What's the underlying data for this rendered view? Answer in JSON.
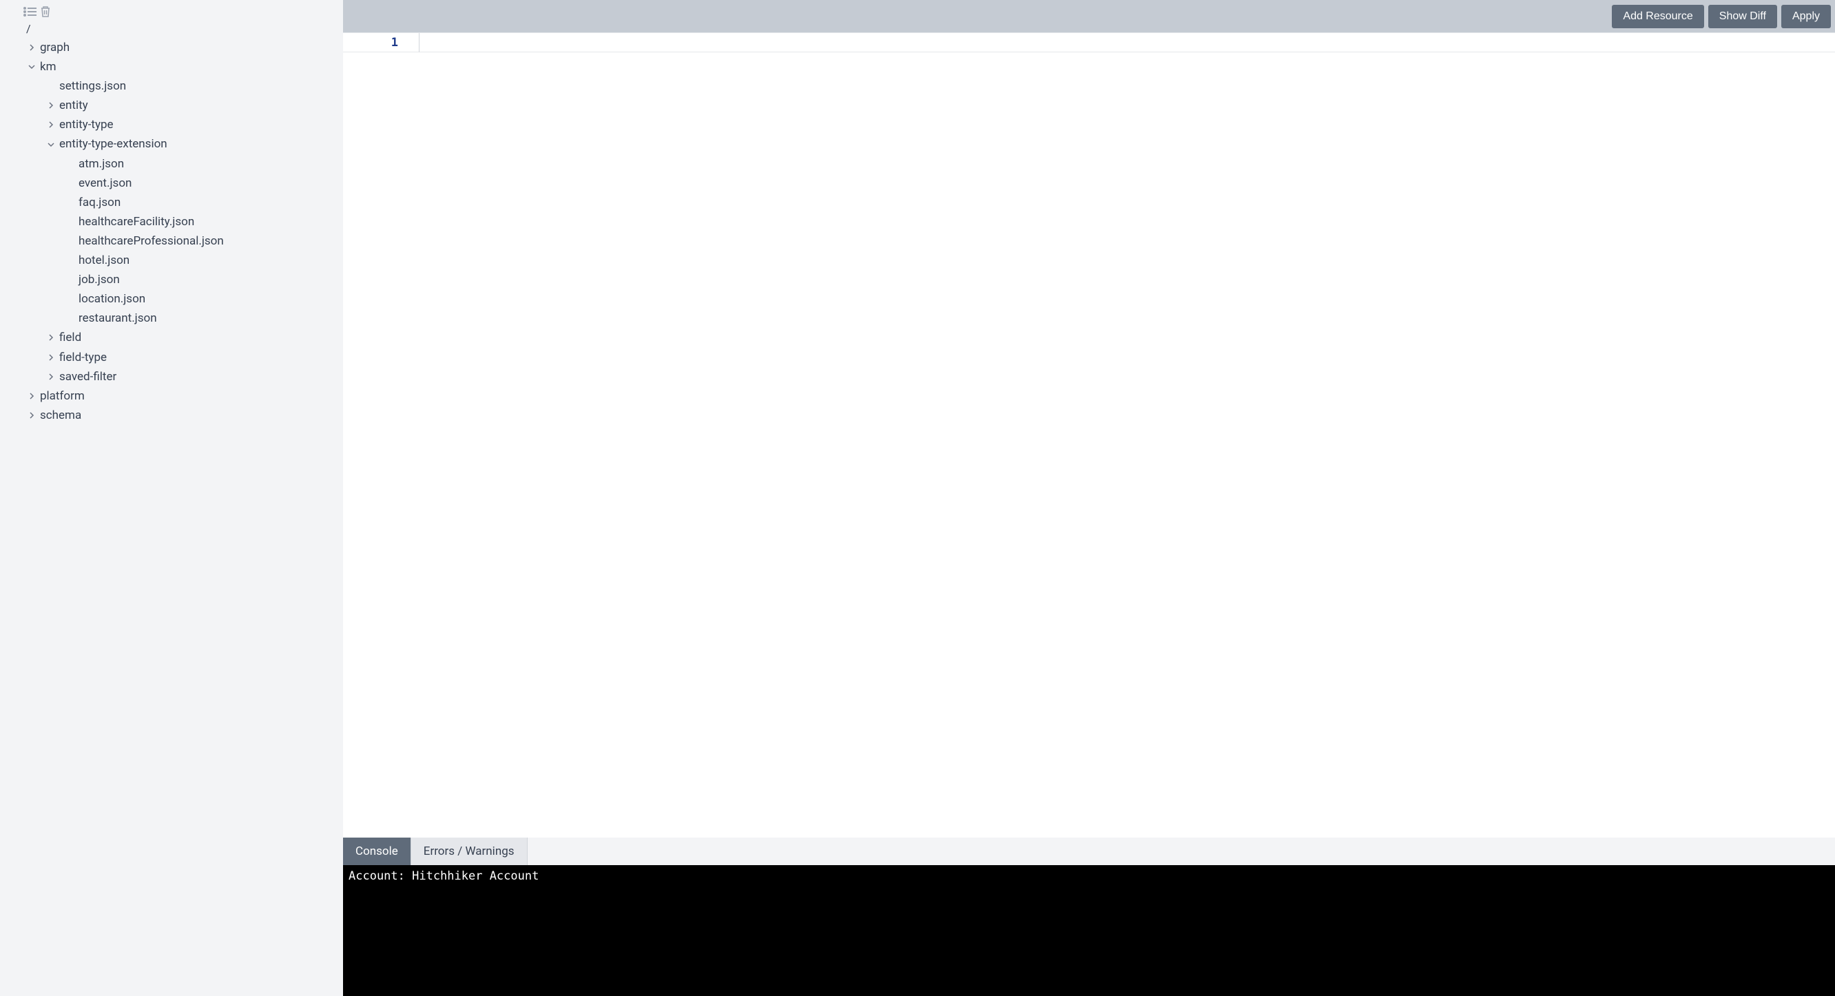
{
  "sidebar": {
    "root": "/",
    "items": [
      {
        "label": "graph",
        "expanded": false,
        "type": "folder",
        "depth": 0
      },
      {
        "label": "km",
        "expanded": true,
        "type": "folder",
        "depth": 0,
        "children": [
          {
            "label": "settings.json",
            "type": "file",
            "depth": 1
          },
          {
            "label": "entity",
            "expanded": false,
            "type": "folder",
            "depth": 1
          },
          {
            "label": "entity-type",
            "expanded": false,
            "type": "folder",
            "depth": 1
          },
          {
            "label": "entity-type-extension",
            "expanded": true,
            "type": "folder",
            "depth": 1,
            "children": [
              {
                "label": "atm.json",
                "type": "file",
                "depth": 2
              },
              {
                "label": "event.json",
                "type": "file",
                "depth": 2
              },
              {
                "label": "faq.json",
                "type": "file",
                "depth": 2
              },
              {
                "label": "healthcareFacility.json",
                "type": "file",
                "depth": 2
              },
              {
                "label": "healthcareProfessional.json",
                "type": "file",
                "depth": 2
              },
              {
                "label": "hotel.json",
                "type": "file",
                "depth": 2
              },
              {
                "label": "job.json",
                "type": "file",
                "depth": 2
              },
              {
                "label": "location.json",
                "type": "file",
                "depth": 2
              },
              {
                "label": "restaurant.json",
                "type": "file",
                "depth": 2
              }
            ]
          },
          {
            "label": "field",
            "expanded": false,
            "type": "folder",
            "depth": 1
          },
          {
            "label": "field-type",
            "expanded": false,
            "type": "folder",
            "depth": 1
          },
          {
            "label": "saved-filter",
            "expanded": false,
            "type": "folder",
            "depth": 1
          }
        ]
      },
      {
        "label": "platform",
        "expanded": false,
        "type": "folder",
        "depth": 0
      },
      {
        "label": "schema",
        "expanded": false,
        "type": "folder",
        "depth": 0
      }
    ]
  },
  "toolbar": {
    "add_resource_label": "Add Resource",
    "show_diff_label": "Show Diff",
    "apply_label": "Apply"
  },
  "editor": {
    "line_number": "1"
  },
  "bottom_panel": {
    "tabs": [
      {
        "label": "Console",
        "active": true
      },
      {
        "label": "Errors / Warnings",
        "active": false
      }
    ],
    "console_output": "Account: Hitchhiker Account"
  }
}
